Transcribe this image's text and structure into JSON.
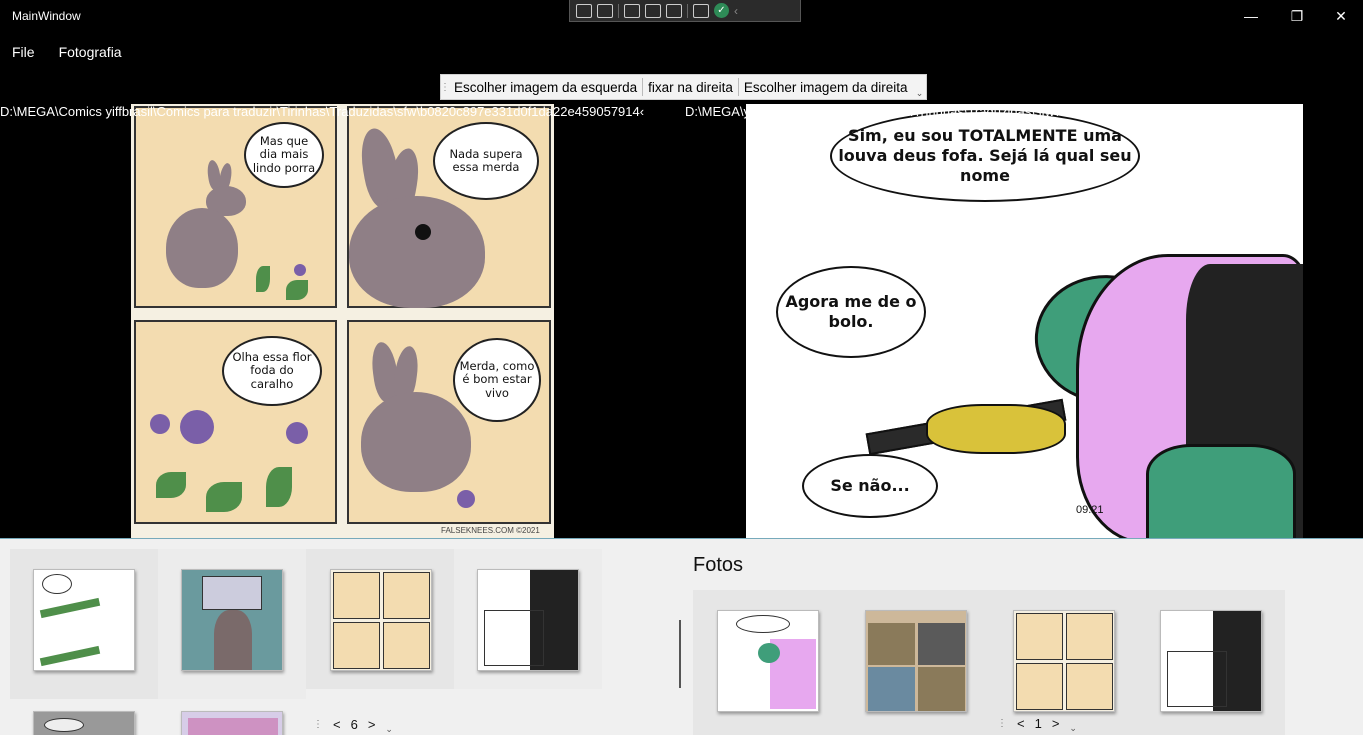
{
  "window": {
    "title": "MainWindow",
    "min_glyph": "—",
    "max_glyph": "❐",
    "close_glyph": "✕"
  },
  "menu": {
    "items": [
      "File",
      "Fotografia"
    ]
  },
  "commandbar": {
    "left_label": "Escolher imagem da esquerda",
    "fix_label": "fixar na direita",
    "right_label": "Escolher imagem da direita",
    "overflow_glyph": "⌄"
  },
  "paths": {
    "left": "D:\\MEGA\\Comics yiffbrasil\\Comics para traduzir\\Tirinhas\\Traduzidas\\sfw\\b0820c897e331d0f1da22e459057914‹",
    "right": "D:\\MEGA\\yiffbrasil\\Comics para traduzir\\Tirinhas\\Traduzidas\\sfw\\Gramma_tartarus_quiver.png"
  },
  "left_comic": {
    "panel1_text": "Mas que dia mais lindo porra",
    "panel2_text": "Nada supera essa merda",
    "panel3_text": "Olha essa flor foda do caralho",
    "panel4_text": "Merda, como é bom estar vivo",
    "signature": "FALSEKNEES.COM ©2021"
  },
  "right_comic": {
    "bubble1": "Sim, eu sou TOTALMENTE uma louva deus fofa. Sejá lá qual seu nome",
    "bubble2": "Agora me de o bolo.",
    "bubble3": "Se não...",
    "signature": "09.21"
  },
  "gallery": {
    "pager_page": "6",
    "prev": "<",
    "next": ">"
  },
  "fotos": {
    "title": "Fotos",
    "pager_page": "1",
    "prev": "<",
    "next": ">"
  },
  "colors": {
    "accent_divider": "#7ab",
    "panel_bg": "#f3dcb0",
    "bunny": "#8f7f86",
    "mantis_green": "#3f9e7a"
  }
}
